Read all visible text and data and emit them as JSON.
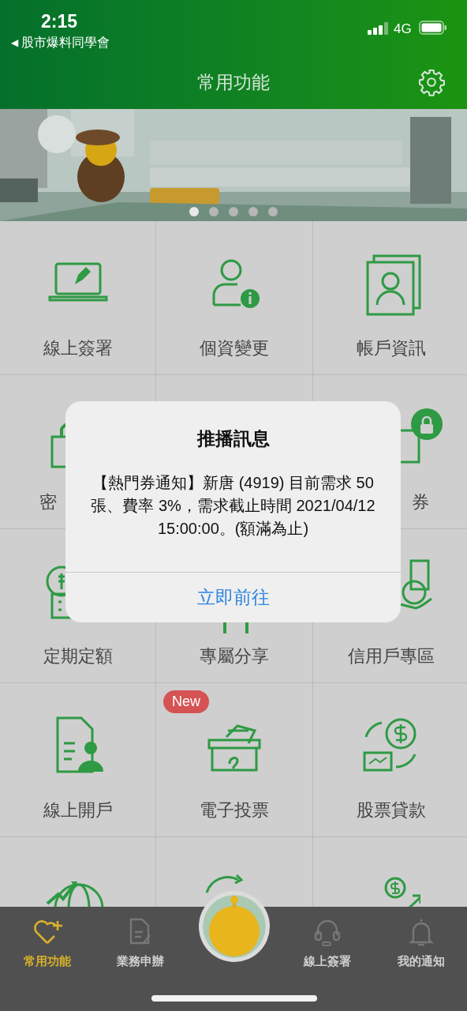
{
  "status_bar": {
    "time": "2:15",
    "back_arrow": "◀",
    "back_label": "股市爆料同學會",
    "network": "4G"
  },
  "header": {
    "title": "常用功能"
  },
  "banner": {
    "kind": "picture",
    "dots": [
      {
        "selected": true
      },
      {
        "selected": false
      },
      {
        "selected": false
      },
      {
        "selected": false
      },
      {
        "selected": false
      }
    ]
  },
  "grid": {
    "items": [
      {
        "kind": "tile",
        "label": "線上簽署"
      },
      {
        "kind": "tile",
        "label": "個資變更"
      },
      {
        "kind": "tile",
        "label": "帳戶資訊"
      },
      {
        "kind": "tile",
        "label": "密"
      },
      {
        "kind": "covered"
      },
      {
        "kind": "tile",
        "label": "券"
      },
      {
        "kind": "tile",
        "label": "定期定額"
      },
      {
        "kind": "tile",
        "label": "專屬分享"
      },
      {
        "kind": "tile",
        "label": "信用戶專區"
      },
      {
        "kind": "tile",
        "label": "線上開戶"
      },
      {
        "kind": "tile",
        "label": "電子投票",
        "badge": "New"
      },
      {
        "kind": "tile",
        "label": "股票貸款"
      },
      {
        "kind": "cut"
      },
      {
        "kind": "cut"
      },
      {
        "kind": "cut"
      }
    ]
  },
  "dialog": {
    "title": "推播訊息",
    "message": "【熱門券通知】新唐 (4919) 目前需求 50張、費率 3%，需求截止時間 2021/04/12 15:00:00。(額滿為止)",
    "button": "立即前往"
  },
  "tab_bar": {
    "items": [
      {
        "label": "常用功能",
        "selected": true
      },
      {
        "label": "業務申辦",
        "selected": false
      },
      {
        "kind": "avatar"
      },
      {
        "label": "線上簽署",
        "selected": false
      },
      {
        "label": "我的通知",
        "selected": false
      }
    ]
  }
}
